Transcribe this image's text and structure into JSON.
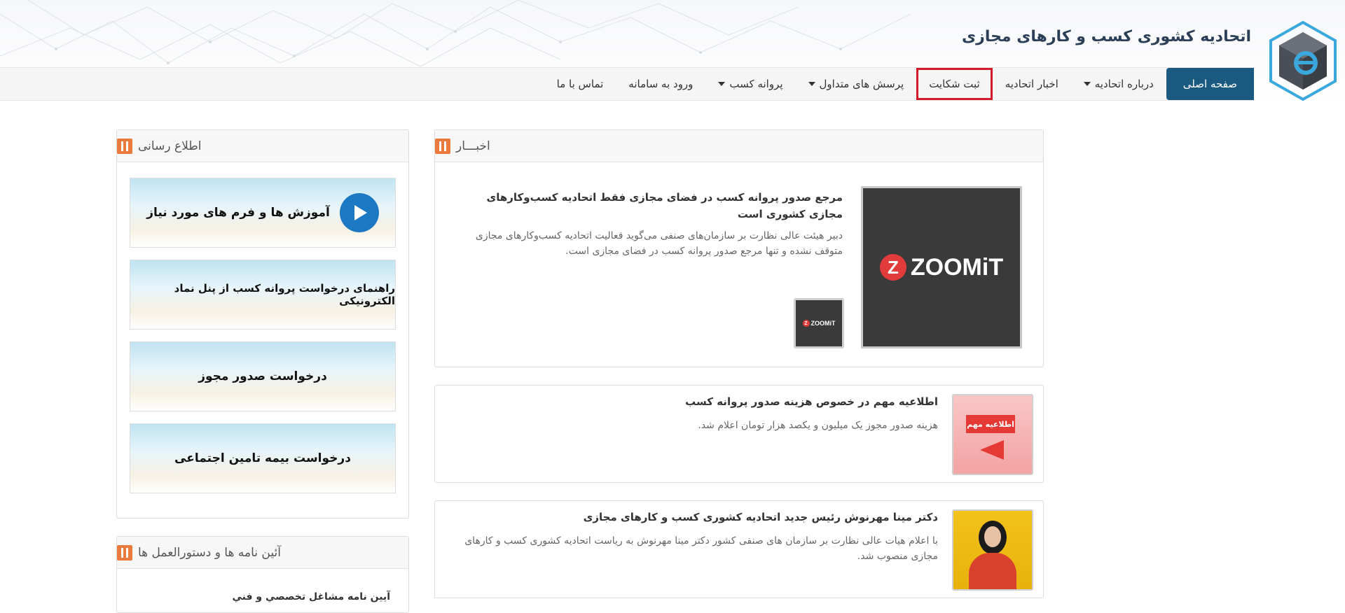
{
  "site": {
    "title": "اتحادیه کشوری کسب و کارهای مجازی"
  },
  "nav": {
    "items": [
      {
        "label": "صفحه اصلی"
      },
      {
        "label": "درباره اتحادیه"
      },
      {
        "label": "اخبار اتحادیه"
      },
      {
        "label": "ثبت شکایت"
      },
      {
        "label": "پرسش های متداول"
      },
      {
        "label": "پروانه کسب"
      },
      {
        "label": "ورود به سامانه"
      },
      {
        "label": "تماس با ما"
      }
    ]
  },
  "news": {
    "heading": "اخبـــار",
    "main": {
      "title": "مرجع صدور پروانه کسب در فضای مجازی فقط اتحادیه کسب‌وکارهای مجازی کشوری است",
      "summary": "دبیر هیئت عالی نظارت بر سازمان‌های صنفی می‌گوید فعالیت اتحادیه کسب‌وکارهای مجازی متوقف نشده و تنها مرجع صدور پروانه کسب در فضای مجازی است.",
      "image_brand": "ZOOMiT"
    },
    "items": [
      {
        "title": "اطلاعیه مهم در خصوص هزینه صدور پروانه کسب",
        "summary": "هزینه صدور مجوز یک میلیون و یکصد هزار تومان اعلام شد.",
        "image_label": "اطلاعیه مهم"
      },
      {
        "title": "دکتر مینا مهرنوش رئیس جدید اتحادیه کشوری کسب و کارهای مجازی",
        "summary": "با اعلام هیات عالی نظارت بر سازمان های صنفی کشور دکتر مینا مهرنوش به ریاست اتحادیه کشوری کسب و کارهای مجازی منصوب شد."
      }
    ]
  },
  "sidebar": {
    "info_heading": "اطلاع رسانی",
    "banners": [
      {
        "text": "آموزش ها و فرم های مورد نیاز"
      },
      {
        "text": "راهنمای درخواست پروانه کسب از پنل نماد الکترونیکی"
      },
      {
        "text": "درخواست صدور مجوز"
      },
      {
        "text": "درخواست بیمه تامین اجتماعی"
      }
    ],
    "rules_heading": "آئین نامه ها و دستورالعمل ها",
    "rules_items": [
      {
        "label": "آيين نامه مشاغل تخصصي و فني"
      }
    ]
  },
  "colors": {
    "nav_active": "#1b5a80",
    "highlight": "#d11a2a",
    "icon": "#e97b3c"
  }
}
